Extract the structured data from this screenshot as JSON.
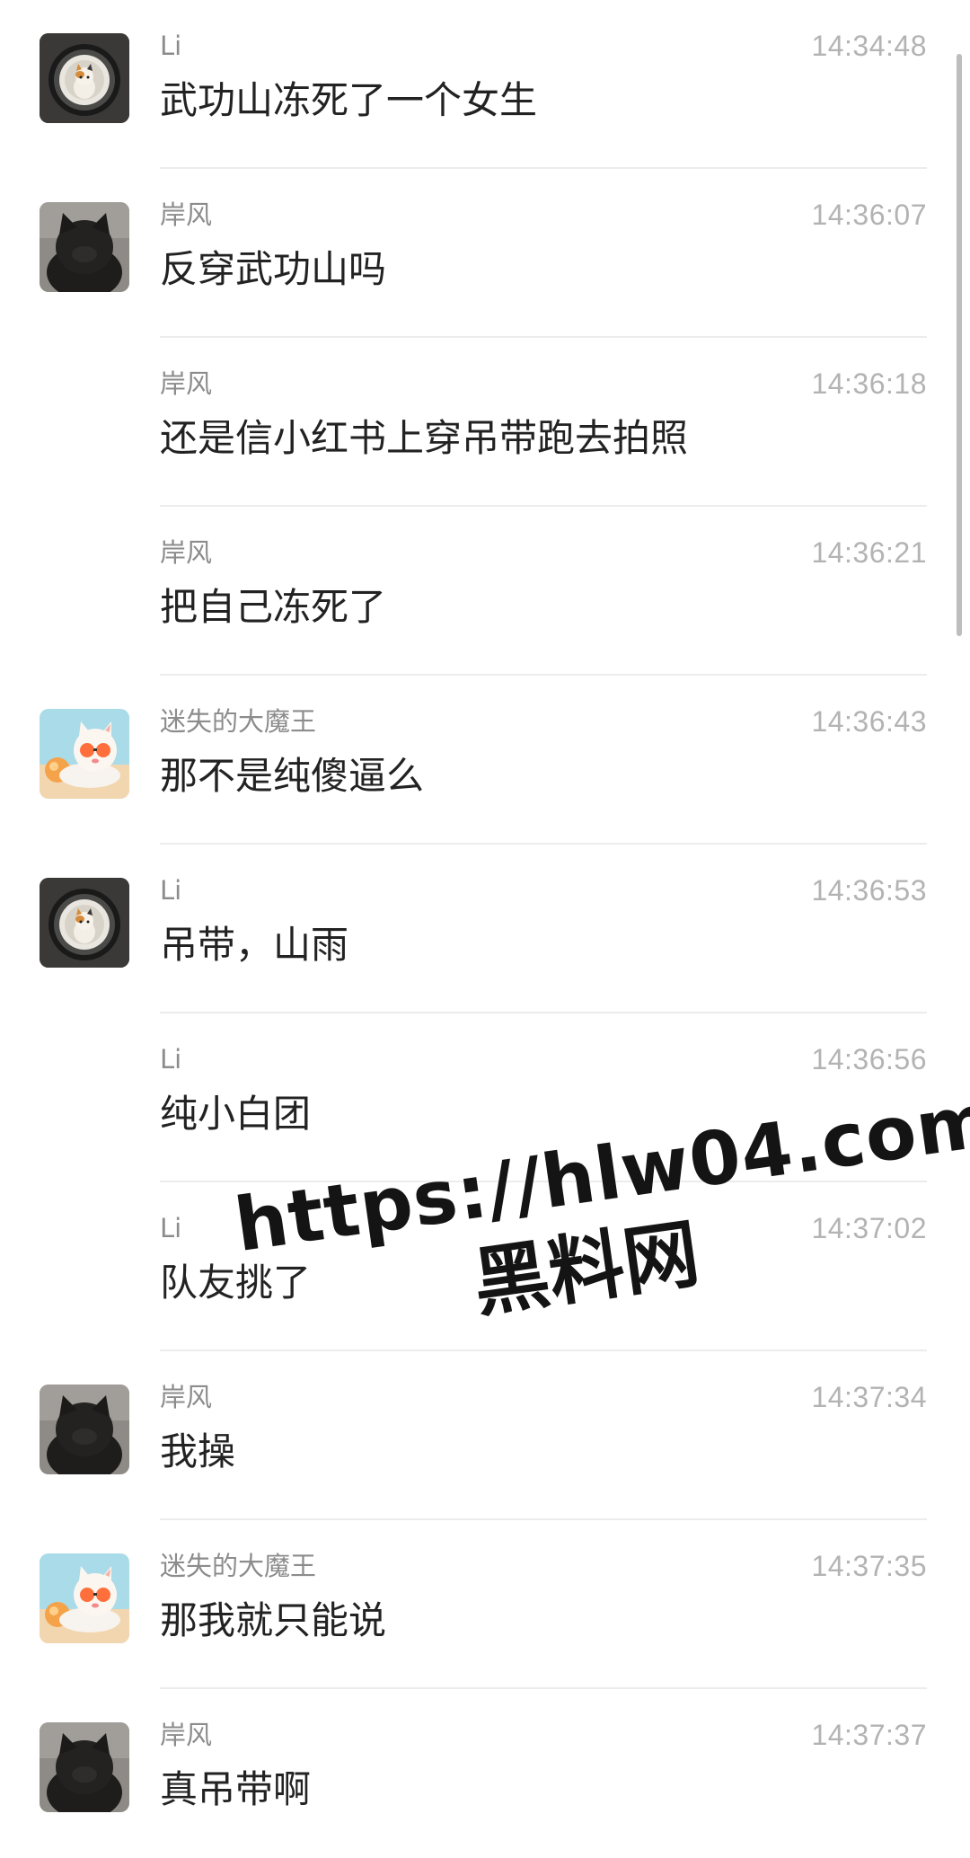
{
  "messages": [
    {
      "sender": "Li",
      "time": "14:34:48",
      "text": "武功山冻死了一个女生",
      "avatar": "li"
    },
    {
      "sender": "岸风",
      "time": "14:36:07",
      "text": "反穿武功山吗",
      "avatar": "anfeng"
    },
    {
      "sender": "岸风",
      "time": "14:36:18",
      "text": "还是信小红书上穿吊带跑去拍照",
      "avatar": ""
    },
    {
      "sender": "岸风",
      "time": "14:36:21",
      "text": "把自己冻死了",
      "avatar": ""
    },
    {
      "sender": "迷失的大魔王",
      "time": "14:36:43",
      "text": "那不是纯傻逼么",
      "avatar": "mowang"
    },
    {
      "sender": "Li",
      "time": "14:36:53",
      "text": "吊带，山雨",
      "avatar": "li"
    },
    {
      "sender": "Li",
      "time": "14:36:56",
      "text": "纯小白团",
      "avatar": ""
    },
    {
      "sender": "Li",
      "time": "14:37:02",
      "text": "队友挑了",
      "avatar": ""
    },
    {
      "sender": "岸风",
      "time": "14:37:34",
      "text": "我操",
      "avatar": "anfeng"
    },
    {
      "sender": "迷失的大魔王",
      "time": "14:37:35",
      "text": "那我就只能说",
      "avatar": "mowang"
    },
    {
      "sender": "岸风",
      "time": "14:37:37",
      "text": "真吊带啊",
      "avatar": "anfeng"
    }
  ],
  "watermark": {
    "url": "https://hlw04.com",
    "name": "黑料网"
  },
  "colors": {
    "sender": "#8c8c8c",
    "time": "#b3b3b3",
    "text": "#222222",
    "divider": "#ececec"
  },
  "icons": {
    "li": "cat-in-washing-machine-avatar-icon",
    "anfeng": "black-cat-avatar-icon",
    "mowang": "cartoon-cat-sunglasses-avatar-icon"
  }
}
